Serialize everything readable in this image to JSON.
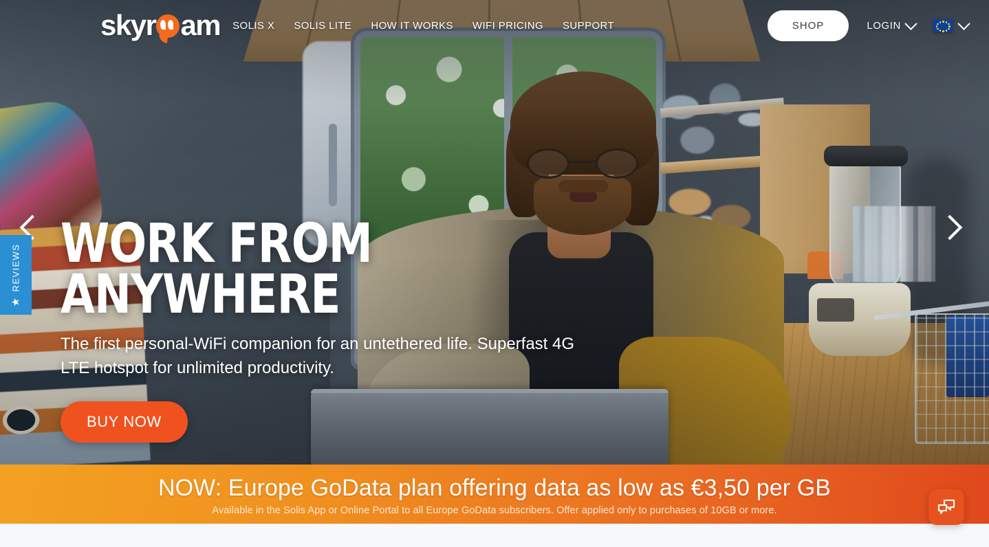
{
  "brand": {
    "name": "skyroam",
    "name_part1": "sky",
    "name_part2": "r",
    "name_part3": "am",
    "accent_color": "#f26b21",
    "logo_icon": "speech-bubble-o-icon"
  },
  "header": {
    "nav": [
      {
        "label": "SOLIS X"
      },
      {
        "label": "SOLIS LITE"
      },
      {
        "label": "HOW IT WORKS"
      },
      {
        "label": "WIFI PRICING"
      },
      {
        "label": "SUPPORT"
      }
    ],
    "shop_label": "SHOP",
    "login_label": "LOGIN",
    "login_chevron_icon": "chevron-down-icon",
    "language_flag_icon": "eu-flag-icon",
    "language_chevron_icon": "chevron-down-icon"
  },
  "hero": {
    "headline": "WORK FROM ANYWHERE",
    "subhead": "The first personal-WiFi companion for an untethered life. Superfast 4G LTE hotspot for unlimited productivity.",
    "cta_label": "BUY NOW",
    "cta_color": "#f0521f",
    "prev_arrow_icon": "chevron-left-icon",
    "next_arrow_icon": "chevron-right-icon"
  },
  "reviews_tab": {
    "label": "REVIEWS",
    "star_icon": "star-icon",
    "background_color": "#2b8fd4"
  },
  "banner": {
    "title": "NOW: Europe GoData plan offering data as low as €3,50 per GB",
    "subtitle": "Available in the Solis App or Online Portal to all Europe GoData subscribers. Offer applied only to purchases of 10GB or more.",
    "gradient_start": "#f3a122",
    "gradient_end": "#e0471d"
  },
  "chat": {
    "icon": "chat-bubbles-icon",
    "background_color": "#e8521f"
  }
}
